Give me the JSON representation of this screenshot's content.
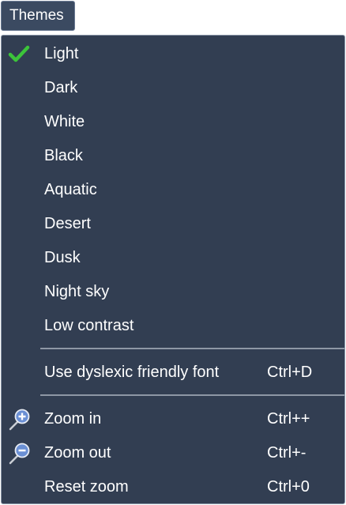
{
  "menu_button": {
    "label": "Themes"
  },
  "menu": {
    "themes": [
      {
        "label": "Light",
        "checked": true
      },
      {
        "label": "Dark",
        "checked": false
      },
      {
        "label": "White",
        "checked": false
      },
      {
        "label": "Black",
        "checked": false
      },
      {
        "label": "Aquatic",
        "checked": false
      },
      {
        "label": "Desert",
        "checked": false
      },
      {
        "label": "Dusk",
        "checked": false
      },
      {
        "label": "Night sky",
        "checked": false
      },
      {
        "label": "Low contrast",
        "checked": false
      }
    ],
    "font_option": {
      "label": "Use dyslexic friendly font",
      "shortcut": "Ctrl+D"
    },
    "zoom": [
      {
        "label": "Zoom in",
        "shortcut": "Ctrl++",
        "icon": "zoom-in-icon"
      },
      {
        "label": "Zoom out",
        "shortcut": "Ctrl+-",
        "icon": "zoom-out-icon"
      },
      {
        "label": "Reset zoom",
        "shortcut": "Ctrl+0"
      }
    ]
  },
  "colors": {
    "menu_background": "#323e52",
    "button_background": "#3b4a61",
    "checkmark": "#3cc43a",
    "zoom_icon": "#6a8fd4"
  }
}
